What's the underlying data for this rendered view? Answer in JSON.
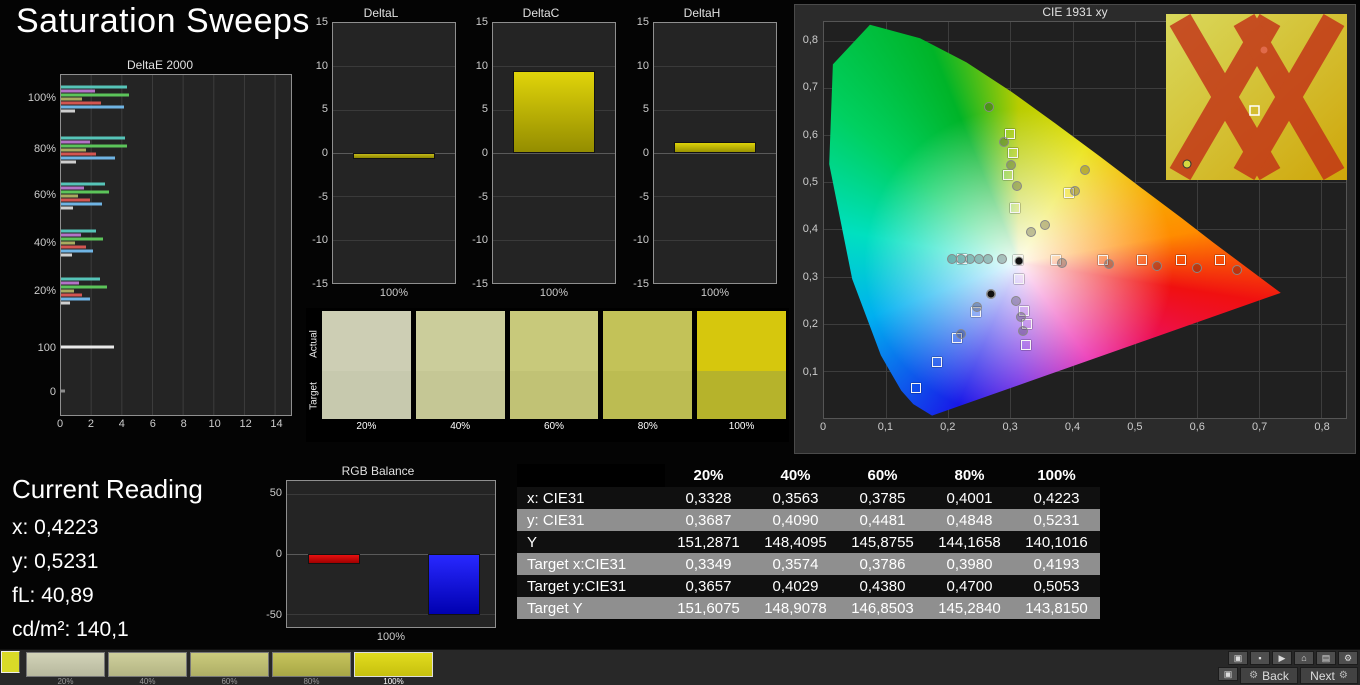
{
  "page": {
    "title": "Saturation Sweeps"
  },
  "deltae_chart": {
    "title": "DeltaE 2000",
    "type": "bar",
    "xmax": 15,
    "xlabels": [
      "0",
      "2",
      "4",
      "6",
      "8",
      "10",
      "12",
      "14"
    ],
    "groups": [
      {
        "label": "100%",
        "center": 7,
        "bars": [
          {
            "c": "#56c4b8",
            "v": 4.3
          },
          {
            "c": "#b273c6",
            "v": 2.2
          },
          {
            "c": "#5cc45a",
            "v": 4.45
          },
          {
            "c": "#a9ab60",
            "v": 1.4
          },
          {
            "c": "#d25551",
            "v": 2.6
          },
          {
            "c": "#6fb4e4",
            "v": 4.1
          },
          {
            "c": "#cfcfcf",
            "v": 0.9
          }
        ]
      },
      {
        "label": "80%",
        "center": 22,
        "bars": [
          {
            "c": "#56c4b8",
            "v": 4.15
          },
          {
            "c": "#b273c6",
            "v": 1.9
          },
          {
            "c": "#5cc45a",
            "v": 4.3
          },
          {
            "c": "#a9ab60",
            "v": 1.6
          },
          {
            "c": "#d25551",
            "v": 2.3
          },
          {
            "c": "#6fb4e4",
            "v": 3.5
          },
          {
            "c": "#cfcfcf",
            "v": 1.0
          }
        ]
      },
      {
        "label": "60%",
        "center": 35.5,
        "bars": [
          {
            "c": "#56c4b8",
            "v": 2.9
          },
          {
            "c": "#b273c6",
            "v": 1.5
          },
          {
            "c": "#5cc45a",
            "v": 3.1
          },
          {
            "c": "#a9ab60",
            "v": 1.1
          },
          {
            "c": "#d25551",
            "v": 1.9
          },
          {
            "c": "#6fb4e4",
            "v": 2.7
          },
          {
            "c": "#cfcfcf",
            "v": 0.8
          }
        ]
      },
      {
        "label": "40%",
        "center": 49.5,
        "bars": [
          {
            "c": "#56c4b8",
            "v": 2.3
          },
          {
            "c": "#b273c6",
            "v": 1.3
          },
          {
            "c": "#5cc45a",
            "v": 2.75
          },
          {
            "c": "#a9ab60",
            "v": 0.9
          },
          {
            "c": "#d25551",
            "v": 1.6
          },
          {
            "c": "#6fb4e4",
            "v": 2.1
          },
          {
            "c": "#cfcfcf",
            "v": 0.7
          }
        ]
      },
      {
        "label": "20%",
        "center": 63.5,
        "bars": [
          {
            "c": "#56c4b8",
            "v": 2.55
          },
          {
            "c": "#b273c6",
            "v": 1.15
          },
          {
            "c": "#5cc45a",
            "v": 3.0
          },
          {
            "c": "#a9ab60",
            "v": 0.85
          },
          {
            "c": "#d25551",
            "v": 1.4
          },
          {
            "c": "#6fb4e4",
            "v": 1.9
          },
          {
            "c": "#cfcfcf",
            "v": 0.6
          }
        ]
      },
      {
        "label": "100",
        "center": 80,
        "bars": [
          {
            "c": "#e9e9e9",
            "v": 3.45
          }
        ]
      },
      {
        "label": "0",
        "center": 93,
        "bars": [
          {
            "c": "#8a8a8a",
            "v": 0.25
          }
        ]
      }
    ]
  },
  "delta_bars": [
    {
      "title": "DeltaL",
      "value": -0.7,
      "range": 15,
      "yticks": [
        "15",
        "10",
        "5",
        "0",
        "-5",
        "-10",
        "-15"
      ],
      "xlabel": "100%",
      "c1": "#c2b81a",
      "c2": "#8f8800"
    },
    {
      "title": "DeltaC",
      "value": 9.5,
      "range": 15,
      "yticks": [
        "15",
        "10",
        "5",
        "0",
        "-5",
        "-10",
        "-15"
      ],
      "xlabel": "100%",
      "c1": "#e0d40a",
      "c2": "#948d00"
    },
    {
      "title": "DeltaH",
      "value": 1.3,
      "range": 15,
      "yticks": [
        "15",
        "10",
        "5",
        "0",
        "-5",
        "-10",
        "-15"
      ],
      "xlabel": "100%",
      "c1": "#ded20a",
      "c2": "#9a9300"
    }
  ],
  "rgb_balance": {
    "title": "RGB Balance",
    "xlabel": "100%",
    "range": 61,
    "yticks": [
      "50",
      "0",
      "-50"
    ],
    "bars": [
      {
        "name": "red",
        "value": -8,
        "c1": "#e81010",
        "c2": "#a00000"
      },
      {
        "name": "green",
        "value": 0,
        "c1": "#00c000",
        "c2": "#007800"
      },
      {
        "name": "blue",
        "value": -51,
        "c1": "#2828ff",
        "c2": "#0000b0"
      }
    ]
  },
  "swatch_panel": {
    "row_labels": [
      "Actual",
      "Target"
    ],
    "items": [
      {
        "label": "20%",
        "actual": "#cdceb4",
        "target": "#c7c9ae"
      },
      {
        "label": "40%",
        "actual": "#cbcd9b",
        "target": "#c5c795"
      },
      {
        "label": "60%",
        "actual": "#c8c97b",
        "target": "#c1c275"
      },
      {
        "label": "80%",
        "actual": "#c3c258",
        "target": "#bcbc52"
      },
      {
        "label": "100%",
        "actual": "#d6c70d",
        "target": "#b6b32b"
      }
    ]
  },
  "cie": {
    "title": "CIE 1931 xy",
    "axis_max": 0.84,
    "origin_label": "0",
    "xticks": [
      "0,1",
      "0,2",
      "0,3",
      "0,4",
      "0,5",
      "0,6",
      "0,7",
      "0,8"
    ],
    "yticks": [
      "0,1",
      "0,2",
      "0,3",
      "0,4",
      "0,5",
      "0,6",
      "0,7",
      "0,8"
    ],
    "targets": [
      [
        0.3,
        0.603
      ],
      [
        0.304,
        0.563
      ],
      [
        0.296,
        0.516
      ],
      [
        0.308,
        0.445
      ],
      [
        0.395,
        0.478
      ],
      [
        0.222,
        0.337
      ],
      [
        0.312,
        0.335
      ],
      [
        0.373,
        0.335
      ],
      [
        0.449,
        0.335
      ],
      [
        0.511,
        0.335
      ],
      [
        0.574,
        0.335
      ],
      [
        0.638,
        0.335
      ],
      [
        0.314,
        0.294
      ],
      [
        0.322,
        0.228
      ],
      [
        0.327,
        0.199
      ],
      [
        0.325,
        0.155
      ],
      [
        0.245,
        0.224
      ],
      [
        0.214,
        0.17
      ],
      [
        0.182,
        0.119
      ],
      [
        0.148,
        0.064
      ]
    ],
    "measured": [
      [
        0.266,
        0.66
      ],
      [
        0.29,
        0.585
      ],
      [
        0.301,
        0.537
      ],
      [
        0.311,
        0.492
      ],
      [
        0.42,
        0.527
      ],
      [
        0.404,
        0.481
      ],
      [
        0.356,
        0.41
      ],
      [
        0.333,
        0.395
      ],
      [
        0.206,
        0.338
      ],
      [
        0.221,
        0.338
      ],
      [
        0.235,
        0.338
      ],
      [
        0.249,
        0.338
      ],
      [
        0.264,
        0.338
      ],
      [
        0.287,
        0.337
      ],
      [
        0.383,
        0.329
      ],
      [
        0.459,
        0.327
      ],
      [
        0.536,
        0.323
      ],
      [
        0.601,
        0.319
      ],
      [
        0.664,
        0.315
      ],
      [
        0.309,
        0.249
      ],
      [
        0.317,
        0.214
      ],
      [
        0.32,
        0.184
      ],
      [
        0.268,
        0.262
      ],
      [
        0.246,
        0.236
      ],
      [
        0.221,
        0.179
      ]
    ],
    "solid": [
      [
        0.313,
        0.334
      ],
      [
        0.268,
        0.262
      ]
    ]
  },
  "overlay": {
    "bg1": "#d9d95c",
    "bg2": "#cfa60a",
    "x_color": "#c22f17"
  },
  "current_reading": {
    "title": "Current Reading",
    "items": [
      {
        "label": "x:",
        "value": "0,4223"
      },
      {
        "label": "y:",
        "value": "0,5231"
      },
      {
        "label": "fL:",
        "value": "40,89"
      },
      {
        "label": "cd/m²:",
        "value": "140,1"
      }
    ]
  },
  "results_table": {
    "columns": [
      "",
      "20%",
      "40%",
      "60%",
      "80%",
      "100%"
    ],
    "rows": [
      {
        "label": "x: CIE31",
        "values": [
          "0,3328",
          "0,3563",
          "0,3785",
          "0,4001",
          "0,4223"
        ]
      },
      {
        "label": "y: CIE31",
        "values": [
          "0,3687",
          "0,4090",
          "0,4481",
          "0,4848",
          "0,5231"
        ]
      },
      {
        "label": "Y",
        "values": [
          "151,2871",
          "148,4095",
          "145,8755",
          "144,1658",
          "140,1016"
        ]
      },
      {
        "label": "Target x:CIE31",
        "values": [
          "0,3349",
          "0,3574",
          "0,3786",
          "0,3980",
          "0,4193"
        ]
      },
      {
        "label": "Target y:CIE31",
        "values": [
          "0,3657",
          "0,4029",
          "0,4380",
          "0,4700",
          "0,5053"
        ]
      },
      {
        "label": "Target Y",
        "values": [
          "151,6075",
          "148,9078",
          "146,8503",
          "145,2840",
          "143,8150"
        ]
      }
    ]
  },
  "filmstrip": {
    "selected_index": 4,
    "items": [
      {
        "label": "20%",
        "c1": "#d2d3b8",
        "c2": "#b7b89d"
      },
      {
        "label": "40%",
        "c1": "#cfd09c",
        "c2": "#b3b483"
      },
      {
        "label": "60%",
        "c1": "#cbcb7d",
        "c2": "#aeae65"
      },
      {
        "label": "80%",
        "c1": "#c6c45c",
        "c2": "#a8a746"
      },
      {
        "label": "100%",
        "c1": "#e2dc1e",
        "c2": "#c6c00e"
      }
    ]
  },
  "nav": {
    "icon_buttons": [
      {
        "name": "display",
        "glyph": "▣"
      },
      {
        "name": "capture",
        "glyph": "▪"
      },
      {
        "name": "play",
        "glyph": "▶"
      },
      {
        "name": "home",
        "glyph": "⌂"
      },
      {
        "name": "layout",
        "glyph": "▤"
      },
      {
        "name": "settings",
        "glyph": "⚙"
      }
    ],
    "monitor_button_glyph": "▣",
    "gear_glyph": "⚙",
    "back_label": "Back",
    "next_label": "Next"
  }
}
